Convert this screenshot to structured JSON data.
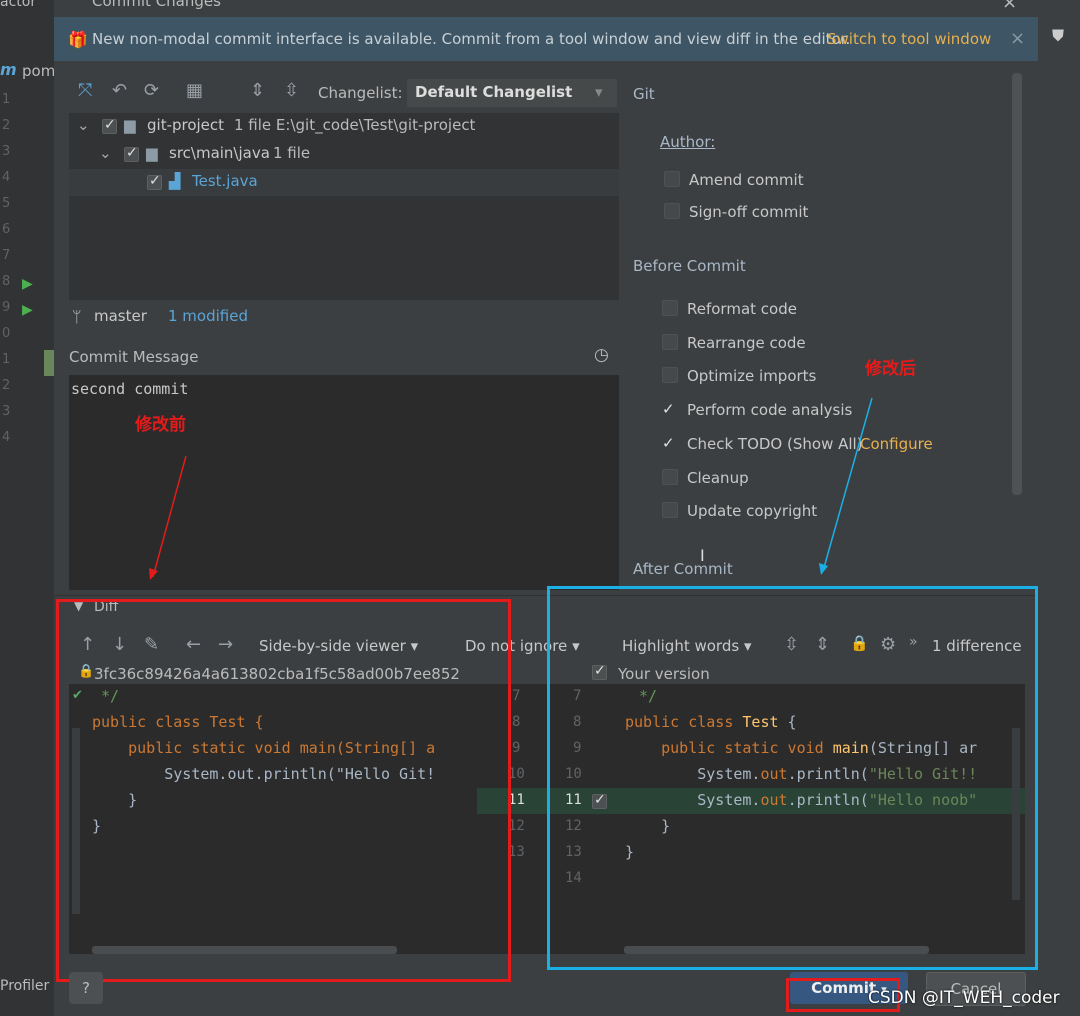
{
  "ide": {
    "top_left_text": "actor",
    "tab_text": "pom",
    "profiler_label": "Profiler",
    "gutter_lines": [
      "1",
      "2",
      "3",
      "4",
      "5",
      "6",
      "7",
      "8",
      "9",
      "0",
      "1",
      "2",
      "3",
      "4"
    ]
  },
  "dialog": {
    "title": "Commit Changes",
    "banner_text": "New non-modal commit interface is available. Commit from a tool window and view diff in the editor.",
    "banner_link": "Switch to tool window",
    "banner_close": "×"
  },
  "toolbar": {
    "changelist_label": "Changelist:",
    "changelist_value": "Default Changelist"
  },
  "tree": {
    "rows": [
      {
        "label": "git-project",
        "detail": "1 file  E:\\git_code\\Test\\git-project"
      },
      {
        "label": "src\\main\\java",
        "detail": "1 file"
      },
      {
        "label": "Test.java",
        "detail": ""
      }
    ]
  },
  "branch": {
    "name": "master",
    "status": "1 modified"
  },
  "commit_message": {
    "label": "Commit Message",
    "value": "second commit"
  },
  "git_panel": {
    "header": "Git",
    "author_label": "Author:",
    "amend": "Amend commit",
    "signoff": "Sign-off commit",
    "before_commit_header": "Before Commit",
    "options": [
      {
        "label": "Reformat code",
        "checked": false
      },
      {
        "label": "Rearrange code",
        "checked": false
      },
      {
        "label": "Optimize imports",
        "checked": false
      },
      {
        "label": "Perform code analysis",
        "checked": true
      },
      {
        "label": "Check TODO (Show All)",
        "checked": true
      },
      {
        "label": "Cleanup",
        "checked": false
      },
      {
        "label": "Update copyright",
        "checked": false
      }
    ],
    "configure_link": "Configure",
    "after_commit_header": "After Commit"
  },
  "diff": {
    "header": "Diff",
    "viewer": "Side-by-side viewer",
    "ignore": "Do not ignore",
    "highlight": "Highlight words",
    "difference_count": "1 difference",
    "left_title": "3fc36c89426a4a613802cba1f5c58ad00b7ee852",
    "right_title": "Your version",
    "left_lines": [
      " */",
      "public class Test {",
      "    public static void main(String[] a",
      "        System.out.println(\"Hello Git!",
      "    }",
      "}"
    ],
    "left_numbers": [
      "7",
      "8",
      "9",
      "10",
      "11",
      "12",
      "13"
    ],
    "right_numbers": [
      "7",
      "8",
      "9",
      "10",
      "11",
      "12",
      "13",
      "14"
    ],
    "right_line_comment": " */",
    "right_line_class": "public class Test {",
    "right_line_main": "    public static void main(String[] ar",
    "right_line_print1": "        System.out.println(\"Hello Git!!",
    "right_line_print2": "        System.out.println(\"Hello noob\"",
    "right_line_close1": "    }",
    "right_line_close2": "}"
  },
  "annotations": {
    "before": "修改前",
    "after": "修改后"
  },
  "footer": {
    "help": "?",
    "commit": "Commit",
    "cancel": "Cancel",
    "watermark": "CSDN @IT_WEH_coder"
  },
  "colors": {
    "red_box": "#e41b1b",
    "blue_box": "#1ab0e6",
    "banner_bg": "#3d5564",
    "link": "#e8b04e"
  }
}
